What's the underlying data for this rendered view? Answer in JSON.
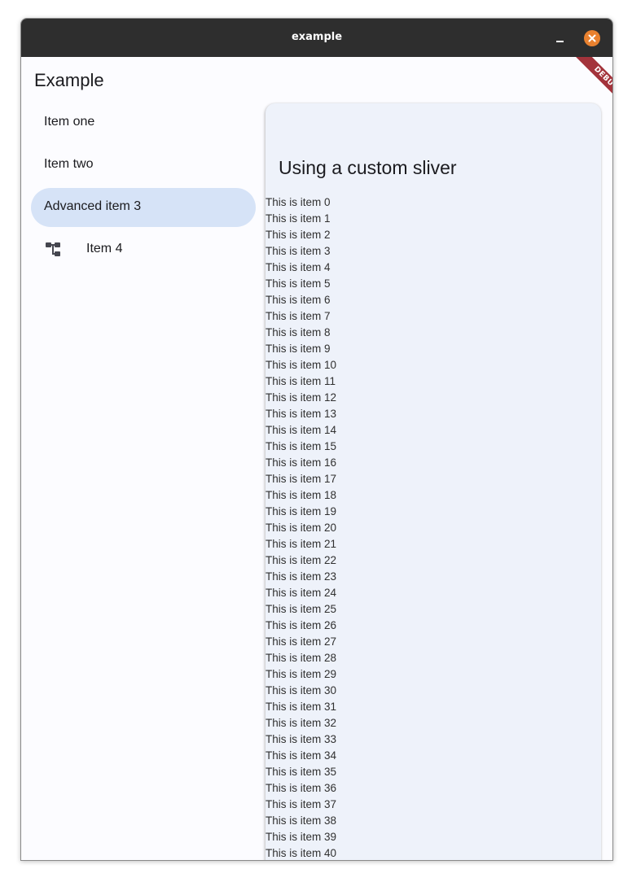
{
  "window": {
    "title": "example"
  },
  "app": {
    "title": "Example",
    "debug_label": "DEBUG"
  },
  "nav": {
    "items": [
      {
        "label": "Item one"
      },
      {
        "label": "Item two"
      },
      {
        "label": "Advanced item 3",
        "selected": true
      },
      {
        "label": "Item 4",
        "icon": "account-tree-icon"
      }
    ]
  },
  "panel": {
    "title": "Using a custom sliver",
    "items": [
      "This is item 0",
      "This is item 1",
      "This is item 2",
      "This is item 3",
      "This is item 4",
      "This is item 5",
      "This is item 6",
      "This is item 7",
      "This is item 8",
      "This is item 9",
      "This is item 10",
      "This is item 11",
      "This is item 12",
      "This is item 13",
      "This is item 14",
      "This is item 15",
      "This is item 16",
      "This is item 17",
      "This is item 18",
      "This is item 19",
      "This is item 20",
      "This is item 21",
      "This is item 22",
      "This is item 23",
      "This is item 24",
      "This is item 25",
      "This is item 26",
      "This is item 27",
      "This is item 28",
      "This is item 29",
      "This is item 30",
      "This is item 31",
      "This is item 32",
      "This is item 33",
      "This is item 34",
      "This is item 35",
      "This is item 36",
      "This is item 37",
      "This is item 38",
      "This is item 39",
      "This is item 40"
    ]
  },
  "colors": {
    "titlebar": "#2e2e2e",
    "close_button": "#e9812f",
    "selected_nav": "#d6e3f7",
    "panel_bg": "#eef2fa",
    "debug_ribbon": "#a3333b"
  }
}
